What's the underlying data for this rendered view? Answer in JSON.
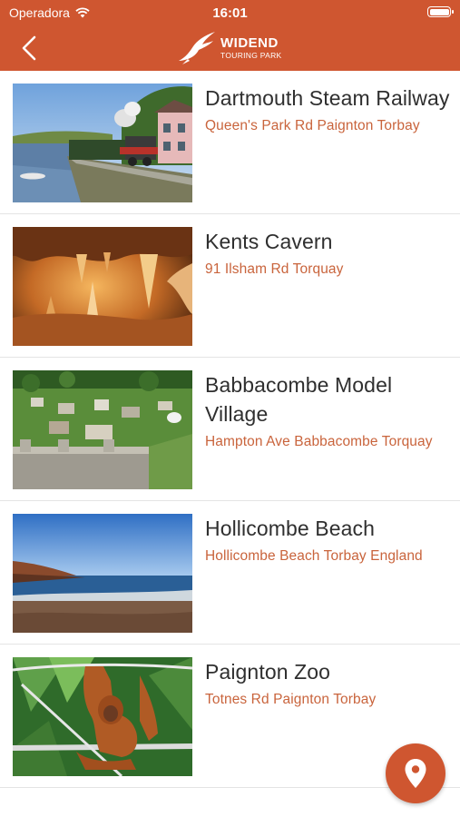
{
  "status_bar": {
    "carrier": "Operadora",
    "time": "16:01"
  },
  "header": {
    "logo_title": "WIDEND",
    "logo_subtitle": "TOURING PARK",
    "accent_color": "#cf5630"
  },
  "items": [
    {
      "title": "Dartmouth Steam Railway",
      "address": "Queen's Park Rd Paignton Torbay",
      "image": "steam-train-photo"
    },
    {
      "title": "Kents Cavern",
      "address": "91 Ilsham Rd Torquay",
      "image": "cavern-photo"
    },
    {
      "title": "Babbacombe Model Village",
      "address": "Hampton Ave Babbacombe Torquay",
      "image": "model-village-photo"
    },
    {
      "title": "Hollicombe Beach",
      "address": "Hollicombe Beach Torbay England",
      "image": "beach-photo"
    },
    {
      "title": "Paignton Zoo",
      "address": "Totnes Rd Paignton Torbay",
      "image": "orangutan-photo"
    }
  ],
  "fab": {
    "icon": "map-pin-icon"
  }
}
